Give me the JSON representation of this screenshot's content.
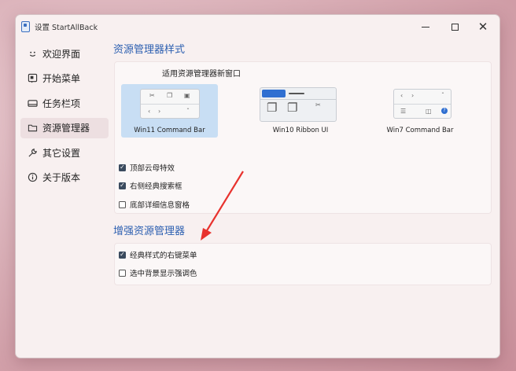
{
  "window": {
    "title": "设置 StartAllBack",
    "minimize_label": "",
    "maximize_label": "",
    "close_label": "✕"
  },
  "sidebar": {
    "items": [
      {
        "label": "欢迎界面",
        "icon": "smile-icon",
        "active": false
      },
      {
        "label": "开始菜单",
        "icon": "start-menu-icon",
        "active": false
      },
      {
        "label": "任务栏项",
        "icon": "taskbar-icon",
        "active": false
      },
      {
        "label": "资源管理器",
        "icon": "folder-icon",
        "active": true
      },
      {
        "label": "其它设置",
        "icon": "wrench-icon",
        "active": false
      },
      {
        "label": "关于版本",
        "icon": "info-icon",
        "active": false
      }
    ]
  },
  "explorer_style": {
    "section_title": "资源管理器样式",
    "option_header": "适用资源管理器新窗口",
    "styles": [
      {
        "label": "Win11 Command Bar",
        "selected": true
      },
      {
        "label": "Win10 Ribbon UI",
        "selected": false
      },
      {
        "label": "Win7 Command Bar",
        "selected": false
      }
    ],
    "checkboxes": [
      {
        "label": "顶部云母特效",
        "checked": true
      },
      {
        "label": "右侧经典搜索框",
        "checked": true
      },
      {
        "label": "底部详细信息窗格",
        "checked": false
      }
    ]
  },
  "explorer_enhance": {
    "section_title": "增强资源管理器",
    "checkboxes": [
      {
        "label": "经典样式的右键菜单",
        "checked": true
      },
      {
        "label": "选中背景显示强调色",
        "checked": false
      }
    ]
  },
  "colors": {
    "accent": "#2c5fb0",
    "selected_card": "#c8def4",
    "annotation_arrow": "#e8322e"
  }
}
